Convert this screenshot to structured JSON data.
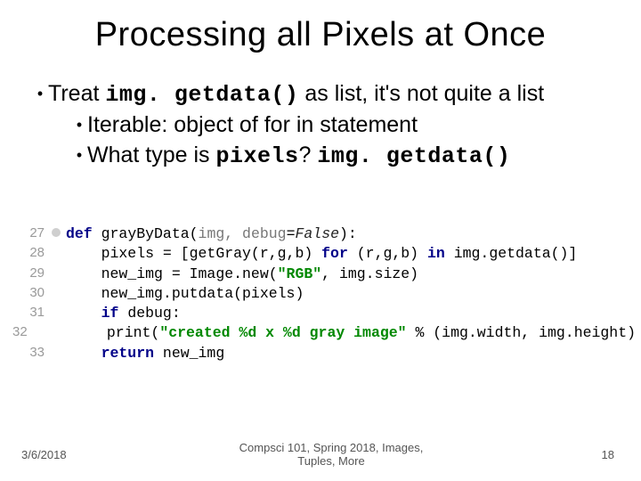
{
  "title": "Processing all Pixels at Once",
  "bullet_main_pre": "Treat ",
  "bullet_main_code": "img. getdata()",
  "bullet_main_post": " as list, it's not quite a list",
  "sub1": "Iterable: object of for in statement",
  "sub2_pre": "What type is ",
  "sub2_code1": "pixels",
  "sub2_mid": "? ",
  "sub2_code2": "img. getdata()",
  "code": {
    "ln27": "27",
    "ln28": "28",
    "ln29": "29",
    "ln30": "30",
    "ln31": "31",
    "ln32": "32",
    "ln33": "33",
    "l27_def": "def ",
    "l27_name": "grayByData",
    "l27_paren_open": "(",
    "l27_arg": "img, debug",
    "l27_eq": "=",
    "l27_false": "False",
    "l27_paren_close": "):",
    "l28": "    pixels = [getGray(r,g,b) ",
    "l28_for": "for",
    "l28_mid": " (r,g,b) ",
    "l28_in": "in",
    "l28_end": " img.getdata()]",
    "l29_a": "    new_img = Image.new(",
    "l29_str": "\"RGB\"",
    "l29_b": ", img.size)",
    "l30": "    new_img.putdata(pixels)",
    "l31_if": "    if ",
    "l31_cond": "debug:",
    "l32_a": "        print(",
    "l32_str": "\"created %d x %d gray image\"",
    "l32_b": " % (img.width, img.height)",
    "l33_ret": "    return ",
    "l33_val": "new_img"
  },
  "footer": {
    "date": "3/6/2018",
    "center1": "Compsci 101, Spring 2018, Images,",
    "center2": "Tuples, More",
    "page": "18"
  }
}
